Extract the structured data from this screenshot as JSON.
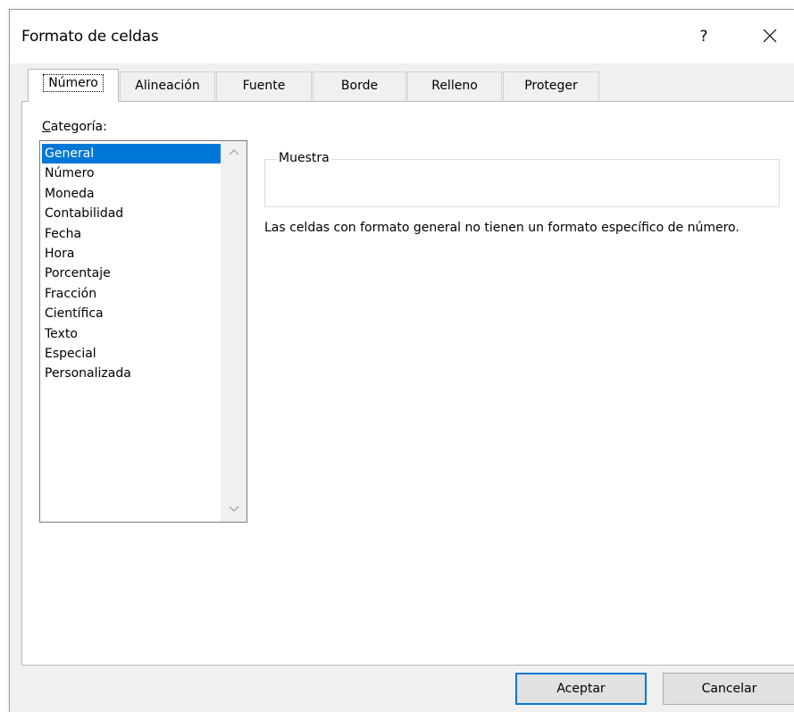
{
  "window": {
    "title": "Formato de celdas",
    "help_label": "?",
    "close_icon": "close-icon"
  },
  "tabs": [
    {
      "label": "Número",
      "active": true
    },
    {
      "label": "Alineación",
      "active": false
    },
    {
      "label": "Fuente",
      "active": false
    },
    {
      "label": "Borde",
      "active": false
    },
    {
      "label": "Relleno",
      "active": false
    },
    {
      "label": "Proteger",
      "active": false
    }
  ],
  "category": {
    "label_underlined": "C",
    "label_rest": "ategoría:",
    "selected": "General",
    "items": [
      "General",
      "Número",
      "Moneda",
      "Contabilidad",
      "Fecha",
      "Hora",
      "Porcentaje",
      "Fracción",
      "Científica",
      "Texto",
      "Especial",
      "Personalizada"
    ]
  },
  "sample": {
    "legend": "Muestra",
    "value": ""
  },
  "description": "Las celdas con formato general no tienen un formato específico de número.",
  "buttons": {
    "ok_label": "Aceptar",
    "cancel_label": "Cancelar"
  },
  "colors": {
    "selection": "#0078d7",
    "dialog_bg": "#f0f0f0",
    "panel_bg": "#ffffff"
  }
}
